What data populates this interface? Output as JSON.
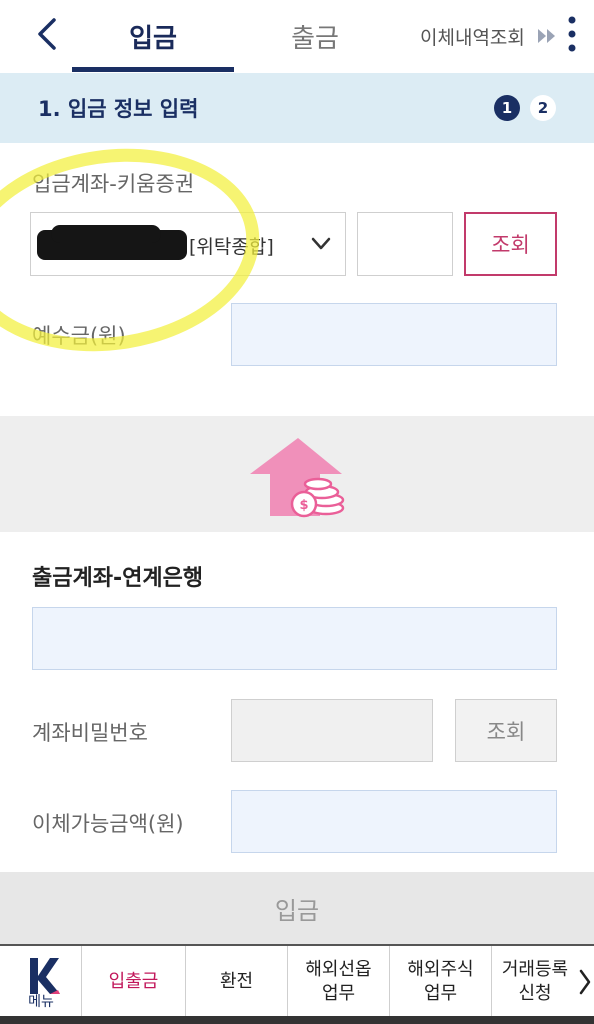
{
  "header": {
    "tabs": [
      {
        "label": "입금",
        "active": true
      },
      {
        "label": "출금",
        "active": false
      }
    ],
    "history_link": "이체내역조회"
  },
  "step": {
    "title": "1. 입금 정보 입력",
    "steps": [
      "1",
      "2"
    ],
    "current": 1
  },
  "deposit": {
    "account_label": "입금계좌-키움증권",
    "account_type": "[위탁종합]",
    "account_number_masked": "(redacted)",
    "inquiry_button": "조회",
    "balance_label": "예수금(원)",
    "balance_value": ""
  },
  "withdraw": {
    "account_label": "출금계좌-연계은행",
    "account_value": "",
    "password_label": "계좌비밀번호",
    "inquiry_button": "조회",
    "available_label": "이체가능금액(원)",
    "available_value": ""
  },
  "submit_label": "입금",
  "bottom_nav": {
    "menu_label": "메뉴",
    "items": [
      {
        "label": "입출금",
        "active": true
      },
      {
        "label": "환전",
        "active": false
      },
      {
        "label": "해외선옵\n업무",
        "active": false
      },
      {
        "label": "해외주식\n업무",
        "active": false
      },
      {
        "label": "거래등록\n신청",
        "active": false
      }
    ]
  },
  "colors": {
    "brand_navy": "#1a2f63",
    "accent_pink": "#c23a6b",
    "step_bar_bg": "#dcecf4",
    "highlight_yellow": "#f2f03c"
  },
  "icons": {
    "back": "chevron-left-icon",
    "fast_forward": "fast-forward-icon",
    "more": "more-vertical-icon",
    "select": "chevron-down-icon",
    "transfer": "transfer-up-coins-icon",
    "nav_next": "chevron-right-icon",
    "brand": "kiwoom-k-logo"
  }
}
